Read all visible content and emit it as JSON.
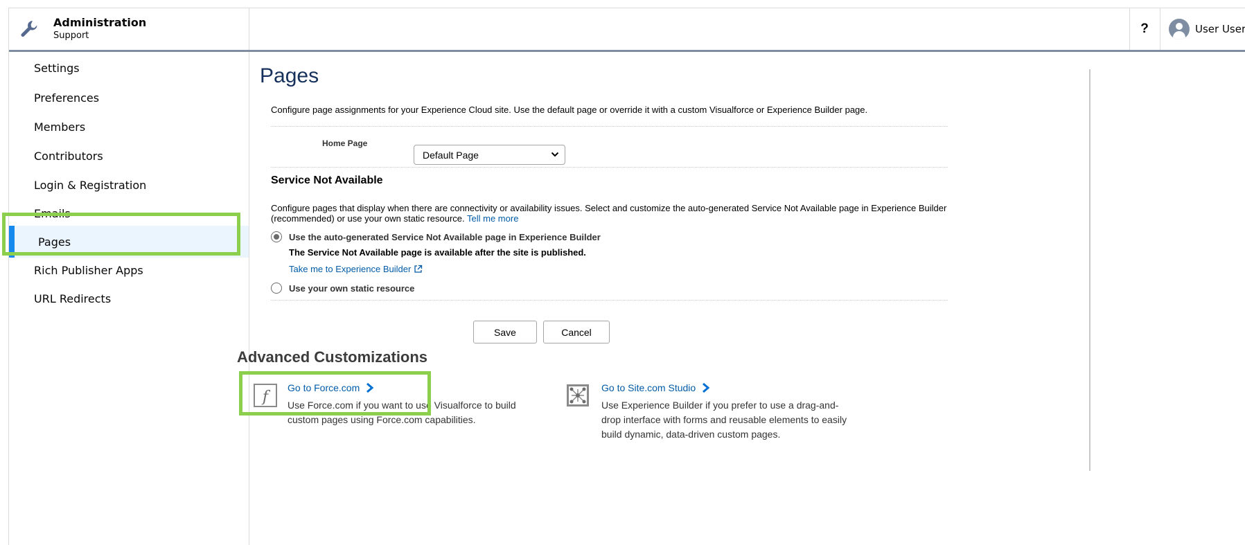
{
  "header": {
    "title": "Administration",
    "subtitle": "Support",
    "help_label": "?",
    "user_name": "User User"
  },
  "sidebar": {
    "items": [
      {
        "label": "Settings"
      },
      {
        "label": "Preferences"
      },
      {
        "label": "Members"
      },
      {
        "label": "Contributors"
      },
      {
        "label": "Login & Registration"
      },
      {
        "label": "Emails"
      },
      {
        "label": "Pages",
        "active": true
      },
      {
        "label": "Rich Publisher Apps"
      },
      {
        "label": "URL Redirects"
      }
    ]
  },
  "main": {
    "title": "Pages",
    "intro": "Configure page assignments for your Experience Cloud site. Use the default page or override it with a custom Visualforce or Experience Builder page.",
    "home_page_label": "Home Page",
    "home_page_value": "Default Page",
    "service_heading": "Service Not Available",
    "service_desc": "Configure pages that display when there are connectivity or availability issues. Select and customize the auto-generated Service Not Available page in Experience Builder (recommended) or use your own static resource.",
    "tell_me_more": "Tell me more",
    "option_auto": "Use the auto-generated Service Not Available page in Experience Builder",
    "option_auto_note": "The Service Not Available page is available after the site is published.",
    "builder_link": "Take me to Experience Builder",
    "option_static": "Use your own static resource",
    "save_label": "Save",
    "cancel_label": "Cancel",
    "advanced_heading": "Advanced Customizations",
    "force_title": "Go to Force.com",
    "force_desc": "Use Force.com if you want to use Visualforce to build custom pages using Force.com capabilities.",
    "site_title": "Go to Site.com Studio",
    "site_desc": "Use Experience Builder if you prefer to use a drag-and-drop interface with forms and reusable elements to easily build dynamic, data-driven custom pages."
  },
  "colors": {
    "accent": "#1589ee",
    "highlight": "#8ccf4c",
    "link": "#015ba7"
  }
}
